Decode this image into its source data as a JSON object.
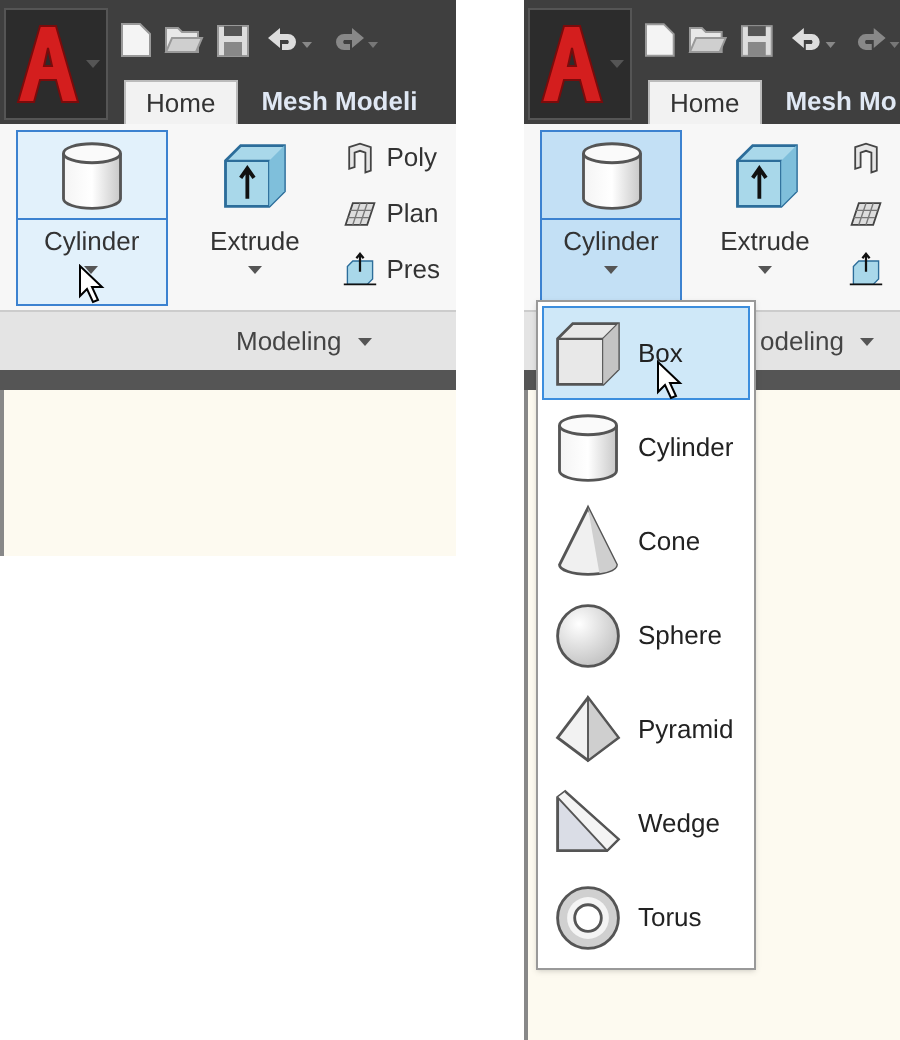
{
  "views": [
    {
      "tabs": [
        {
          "label": "Home",
          "selected": true
        },
        {
          "label": "Mesh Modeli",
          "selected": false
        }
      ],
      "tools": [
        {
          "label": "Cylinder",
          "kind": "cylinder",
          "hovered": true,
          "expanded": false
        },
        {
          "label": "Extrude",
          "kind": "extrude",
          "hovered": false,
          "expanded": false
        }
      ],
      "small_tools": [
        {
          "kind": "polysolid",
          "label": "Poly"
        },
        {
          "kind": "planar",
          "label": "Plan"
        },
        {
          "kind": "presspull",
          "label": "Pres"
        }
      ],
      "panel_title": "Modeling"
    },
    {
      "tabs": [
        {
          "label": "Home",
          "selected": true
        },
        {
          "label": "Mesh Mo",
          "selected": false
        }
      ],
      "tools": [
        {
          "label": "Cylinder",
          "kind": "cylinder",
          "hovered": true,
          "expanded": true
        },
        {
          "label": "Extrude",
          "kind": "extrude",
          "hovered": false,
          "expanded": false
        }
      ],
      "small_tools": [
        {
          "kind": "polysolid"
        },
        {
          "kind": "planar"
        },
        {
          "kind": "presspull"
        }
      ],
      "panel_title": "odeling",
      "menu": [
        {
          "label": "Box",
          "kind": "box",
          "selected": true
        },
        {
          "label": "Cylinder",
          "kind": "cylinder",
          "selected": false
        },
        {
          "label": "Cone",
          "kind": "cone",
          "selected": false
        },
        {
          "label": "Sphere",
          "kind": "sphere",
          "selected": false
        },
        {
          "label": "Pyramid",
          "kind": "pyramid",
          "selected": false
        },
        {
          "label": "Wedge",
          "kind": "wedge",
          "selected": false
        },
        {
          "label": "Torus",
          "kind": "torus",
          "selected": false
        }
      ]
    }
  ]
}
